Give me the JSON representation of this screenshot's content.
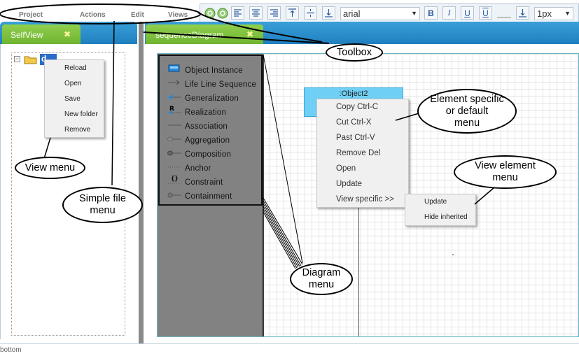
{
  "menubar": {
    "items": [
      "Project",
      "Actions",
      "Edit",
      "Views"
    ]
  },
  "toolbox": {
    "font_value": "arial",
    "size_value": "1px",
    "bold": "B",
    "italic": "I",
    "underline": "U",
    "overline": "U"
  },
  "left_panel": {
    "tab_label": "SelfView",
    "tab_close": "✖",
    "tree_root_label": "d"
  },
  "right_panel": {
    "tab_label": "sequenceDiagram",
    "tab_close": "✖"
  },
  "tree_menu": {
    "items": [
      "Reload",
      "Open",
      "Save",
      "New folder",
      "Remove"
    ]
  },
  "palette": {
    "items": [
      {
        "label": "Object Instance",
        "icon": "object-instance-icon"
      },
      {
        "label": "Life Line Sequence",
        "icon": "lifeline-icon"
      },
      {
        "label": "Generalization",
        "icon": "generalization-icon"
      },
      {
        "label": "Realization",
        "icon": "realization-icon"
      },
      {
        "label": "Association",
        "icon": "association-icon"
      },
      {
        "label": "Aggregation",
        "icon": "aggregation-icon"
      },
      {
        "label": "Composition",
        "icon": "composition-icon"
      },
      {
        "label": "Anchor",
        "icon": "anchor-icon"
      },
      {
        "label": "Constraint",
        "icon": "constraint-icon"
      },
      {
        "label": "Containment",
        "icon": "containment-icon"
      }
    ]
  },
  "diagram": {
    "object_label": ":Object2",
    "stray_mark": "'"
  },
  "element_menu": {
    "items": [
      "Copy Ctrl-C",
      "Cut Ctrl-X",
      "Past Ctrl-V",
      "Remove Del",
      "Open",
      "Update",
      "View specific >>"
    ]
  },
  "view_submenu": {
    "items": [
      "Update",
      "Hide inherited"
    ]
  },
  "callouts": {
    "toolbox": "Toolbox",
    "view_menu": "View menu",
    "simple_file_menu_1": "Simple file",
    "simple_file_menu_2": "menu",
    "element_menu_1": "Element specific",
    "element_menu_2": "or default",
    "element_menu_3": "menu",
    "view_element_menu_1": "View element",
    "view_element_menu_2": "menu",
    "diagram_menu_1": "Diagram",
    "diagram_menu_2": "menu"
  },
  "status": {
    "text": "bottom"
  },
  "colors": {
    "tab_green": "#7cc23e",
    "tab_bar_blue": "#2a8fce",
    "object_fill": "#6fcff5",
    "palette_gray": "#828282",
    "toolbar_bg": "#eef3f8"
  }
}
